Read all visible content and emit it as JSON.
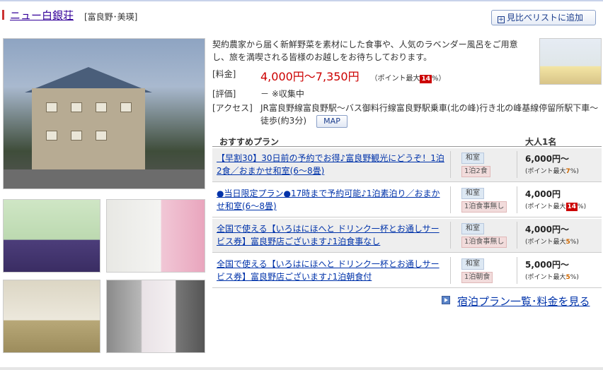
{
  "header": {
    "hotel_name": "ニュー白銀荘",
    "area": "[富良野･美瑛]",
    "compare_button": "見比べリストに追加"
  },
  "description": "契約農家から届く新鮮野菜を素材にした食事や、人気のラベンダー風呂をご用意し、旅を満喫される皆様のお越しをお待ちしております。",
  "info": {
    "price_label": "[料金]",
    "price_value": "4,000円～7,350円",
    "price_point_prefix": "（ポイント最大",
    "price_point_badge": "14",
    "price_point_suffix": "%）",
    "rating_label": "[評価]",
    "rating_value": "－ ※収集中",
    "access_label": "[アクセス]",
    "access_value": "JR富良野線富良野駅～バス御料行線富良野駅乗車(北の峰)行き北の峰基線停留所駅下車～徒歩(約3分)",
    "map_button": "MAP"
  },
  "plans_header": {
    "plan_col": "おすすめプラン",
    "price_col": "大人1名"
  },
  "plans": [
    {
      "title": "【早割30】30日前の予約でお得♪富良野観光にどうぞ！1泊2食／おまかせ和室(6～8畳)",
      "room": "和室",
      "meal": "1泊2食",
      "price": "6,000円～",
      "point_prefix": "(ポイント最大",
      "point": "7",
      "point_suffix": "%)"
    },
    {
      "title": "●当日限定プラン●17時まで予約可能♪1泊素泊り／おまかせ和室(6～8畳)",
      "room": "和室",
      "meal": "1泊食事無し",
      "price": "4,000円",
      "point_prefix": "(ポイント最大",
      "point": "14",
      "point_suffix": "%)"
    },
    {
      "title": "全国で使える【いろはにほへと ドリンク一杯とお通しサービス券】富良野店ございます♪1泊食事なし",
      "room": "和室",
      "meal": "1泊食事無し",
      "price": "4,000円～",
      "point_prefix": "(ポイント最大",
      "point": "5",
      "point_suffix": "%)"
    },
    {
      "title": "全国で使える【いろはにほへと ドリンク一杯とお通しサービス券】富良野店ございます♪1泊朝食付",
      "room": "和室",
      "meal": "1泊朝食",
      "price": "5,000円～",
      "point_prefix": "(ポイント最大",
      "point": "5",
      "point_suffix": "%)"
    }
  ],
  "list_link": "宿泊プラン一覧･料金を見る",
  "colors": {
    "link": "#0033aa",
    "price_red": "#cc0000",
    "point_badge": "#cc0000",
    "room_tag_bg": "#dde8f3",
    "meal_tag_bg": "#f2dcdc"
  }
}
